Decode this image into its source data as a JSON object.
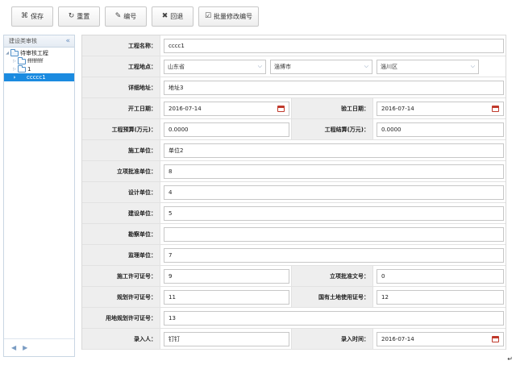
{
  "toolbar": {
    "buttons": [
      {
        "label": "保存",
        "icon": "save-icon",
        "glyph": "⌘"
      },
      {
        "label": "重置",
        "icon": "reset-icon",
        "glyph": "↻"
      },
      {
        "label": "编号",
        "icon": "pencil-icon",
        "glyph": "✎"
      },
      {
        "label": "回退",
        "icon": "close-icon",
        "glyph": "✖"
      },
      {
        "label": "批量修改编号",
        "icon": "checkbox-icon",
        "glyph": "☑"
      }
    ]
  },
  "left_panel": {
    "title": "建设类审核",
    "tree": [
      {
        "label": "待审核工程",
        "level": 0,
        "open": true
      },
      {
        "label": "ffffffff",
        "level": 1
      },
      {
        "label": "1",
        "level": 1
      },
      {
        "label": "ccccc1",
        "level": 1,
        "selected": true
      }
    ]
  },
  "form": {
    "project_name": {
      "label": "工程名称：",
      "value": "cccc1"
    },
    "location": {
      "label": "工程地点：",
      "province": "山东省",
      "city": "淄博市",
      "district": "淄川区"
    },
    "address": {
      "label": "详细地址：",
      "value": "地址3"
    },
    "start_date": {
      "label": "开工日期：",
      "value": "2016-07-14"
    },
    "acceptance_date": {
      "label": "验工日期：",
      "value": "2016-07-14"
    },
    "budget": {
      "label": "工程预算(万元)：",
      "value": "0.0000"
    },
    "settlement": {
      "label": "工程结算(万元)：",
      "value": "0.0000"
    },
    "construction_unit": {
      "label": "施工单位：",
      "value": "单位2"
    },
    "approval_unit": {
      "label": "立项批准单位：",
      "value": "8"
    },
    "design_unit": {
      "label": "设计单位：",
      "value": "4"
    },
    "builder_unit": {
      "label": "建设单位：",
      "value": "5"
    },
    "survey_unit": {
      "label": "勘察单位：",
      "value": ""
    },
    "supervision_unit": {
      "label": "监理单位：",
      "value": "7"
    },
    "construction_permit": {
      "label": "施工许可证号：",
      "value": "9"
    },
    "approval_doc": {
      "label": "立项批准文号：",
      "value": "0"
    },
    "planning_permit": {
      "label": "规划许可证号：",
      "value": "11"
    },
    "land_use_cert": {
      "label": "国有土地使用证号：",
      "value": "12"
    },
    "land_planning_permit": {
      "label": "用地规划许可证号：",
      "value": "13"
    },
    "entered_by": {
      "label": "录入人：",
      "value": "钉钉"
    },
    "entered_time": {
      "label": "录入时间：",
      "value": "2016-07-14"
    }
  },
  "colors": {
    "selected": "#1b8be0",
    "label_bg": "#eeeeee"
  }
}
